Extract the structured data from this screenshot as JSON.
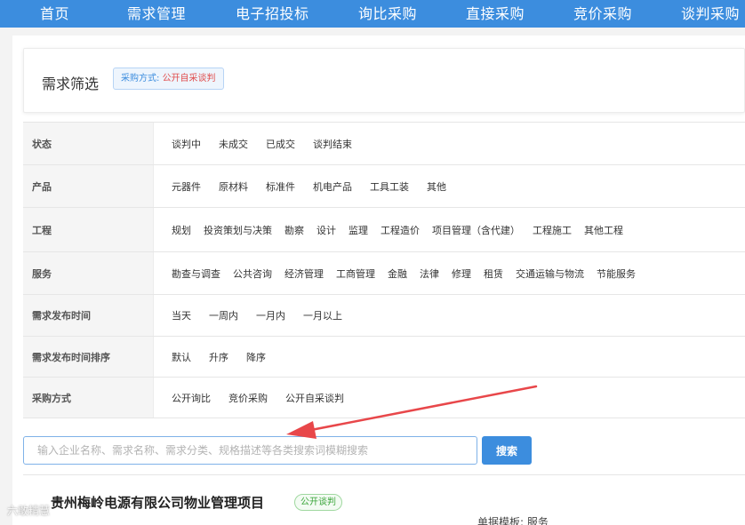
{
  "nav": {
    "items": [
      "首页",
      "需求管理",
      "电子招投标",
      "询比采购",
      "直接采购",
      "竞价采购",
      "谈判采购"
    ]
  },
  "filter": {
    "title": "需求筛选",
    "tag_label": "采购方式: ",
    "tag_value": "公开自采谈判"
  },
  "rows": [
    {
      "label": "状态",
      "options": [
        "谈判中",
        "未成交",
        "已成交",
        "谈判结束"
      ]
    },
    {
      "label": "产品",
      "options": [
        "元器件",
        "原材料",
        "标准件",
        "机电产品",
        "工具工装",
        "其他"
      ]
    },
    {
      "label": "工程",
      "options": [
        "规划",
        "投资策划与决策",
        "勘察",
        "设计",
        "监理",
        "工程造价",
        "项目管理（含代建）",
        "工程施工",
        "其他工程"
      ]
    },
    {
      "label": "服务",
      "options": [
        "勘查与调查",
        "公共咨询",
        "经济管理",
        "工商管理",
        "金融",
        "法律",
        "修理",
        "租赁",
        "交通运输与物流",
        "节能服务"
      ]
    },
    {
      "label": "需求发布时间",
      "options": [
        "当天",
        "一周内",
        "一月内",
        "一月以上"
      ]
    },
    {
      "label": "需求发布时间排序",
      "options": [
        "默认",
        "升序",
        "降序"
      ]
    },
    {
      "label": "采购方式",
      "options": [
        "公开询比",
        "竞价采购",
        "公开自采谈判"
      ]
    }
  ],
  "search": {
    "placeholder": "输入企业名称、需求名称、需求分类、规格描述等各类搜索词模糊搜索",
    "button": "搜索"
  },
  "result": {
    "title": "贵州梅岭电源有限公司物业管理项目",
    "badge": "公开谈判",
    "meta": "单据模板:  服务"
  },
  "watermark": "六敢精慧",
  "colors": {
    "nav_bg": "#3c8dde",
    "accent": "#3c8dde",
    "tag_value": "#e04e4e",
    "badge": "#3aa53a",
    "arrow": "#e8474a"
  }
}
